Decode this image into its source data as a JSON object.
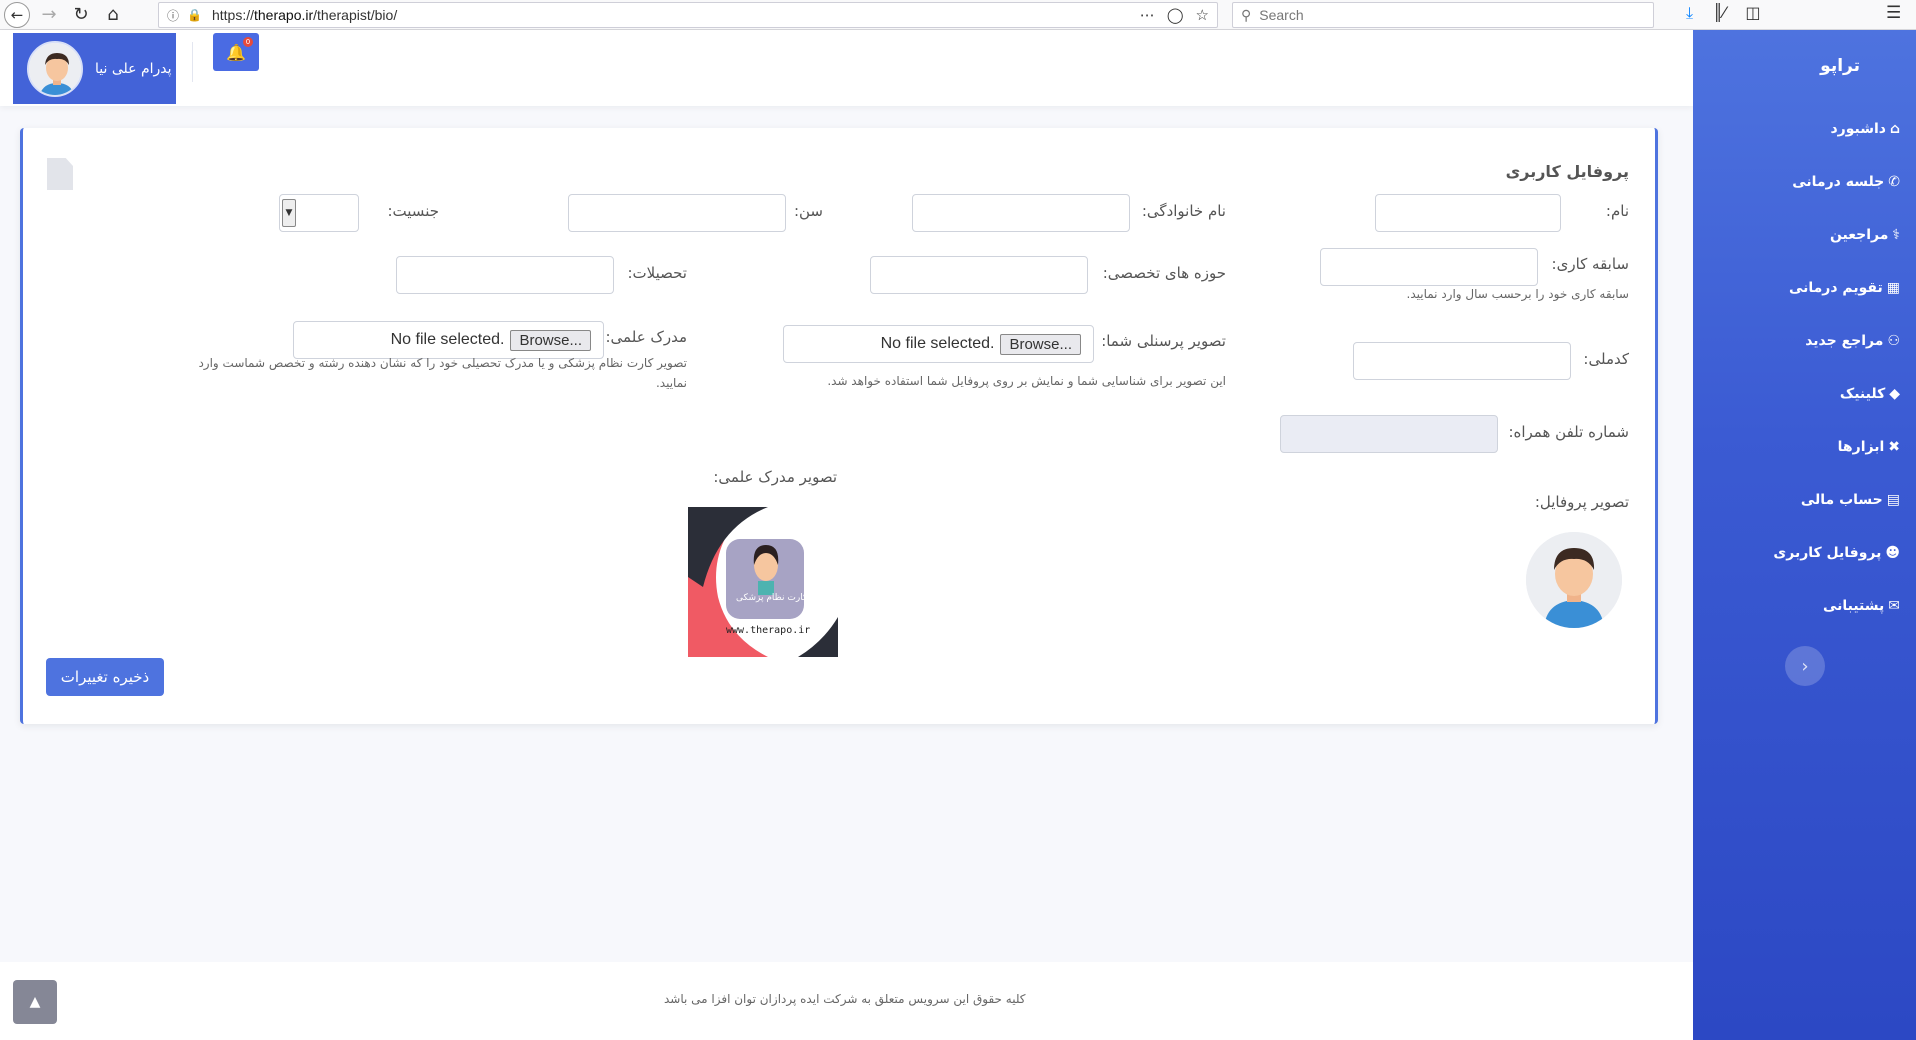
{
  "browser": {
    "url_prefix": "https://",
    "url_domain": "therapo.ir",
    "url_path": "/therapist/bio/",
    "search_placeholder": "Search"
  },
  "header": {
    "user_name": "پدرام علی نیا",
    "notification_count": "0"
  },
  "sidebar": {
    "brand": "تراپو",
    "items": [
      {
        "label": "داشبورد",
        "icon": "home-icon"
      },
      {
        "label": "جلسه درمانی",
        "icon": "phone-icon"
      },
      {
        "label": "مراجعین",
        "icon": "user-md-icon"
      },
      {
        "label": "تقویم درمانی",
        "icon": "calendar-icon"
      },
      {
        "label": "مراجع جدید",
        "icon": "users-icon"
      },
      {
        "label": "کلینیک",
        "icon": "gem-icon"
      },
      {
        "label": "ابزارها",
        "icon": "tools-icon"
      },
      {
        "label": "حساب مالی",
        "icon": "credit-card-icon"
      },
      {
        "label": "پروفایل کاربری",
        "icon": "user-icon"
      },
      {
        "label": "پشتیبانی",
        "icon": "comments-icon"
      }
    ]
  },
  "form": {
    "title": "پروفایل کاربری",
    "first_name_label": "نام:",
    "last_name_label": "نام خانوادگی:",
    "age_label": "سن:",
    "gender_label": "جنسیت:",
    "experience_label": "سابقه کاری:",
    "experience_help": "سابقه کاری خود را برحسب سال وارد نمایید.",
    "specialties_label": "حوزه های تخصصی:",
    "education_label": "تحصیلات:",
    "national_code_label": "کدملی:",
    "personal_photo_label": "تصویر پرسنلی شما:",
    "personal_photo_help": "این تصویر برای شناسایی شما و نمایش بر روی پروفایل شما استفاده خواهد شد.",
    "degree_label": "مدرک علمی:",
    "degree_help": "تصویر کارت نظام پزشکی و یا مدرک تحصیلی خود را که نشان دهنده رشته و تخصص شماست وارد نمایید.",
    "phone_label": "شماره تلفن همراه:",
    "profile_image_label": "تصویر پروفایل:",
    "degree_image_label": "تصویر مدرک علمی:",
    "browse_label": "Browse...",
    "no_file_label": "No file selected.",
    "cert_card_text": "کارت نظام پزشکی",
    "cert_card_url": "www.therapo.ir",
    "save_label": "ذخیره تغییرات"
  },
  "footer": {
    "copyright": "کلیه حقوق این سرویس متعلق به شرکت ایده پردازان توان افزا می باشد"
  },
  "colors": {
    "primary": "#4e73df",
    "sidebar_dark": "#2c48c4",
    "cert_red": "#f05a64",
    "cert_dark": "#2b2e38"
  }
}
